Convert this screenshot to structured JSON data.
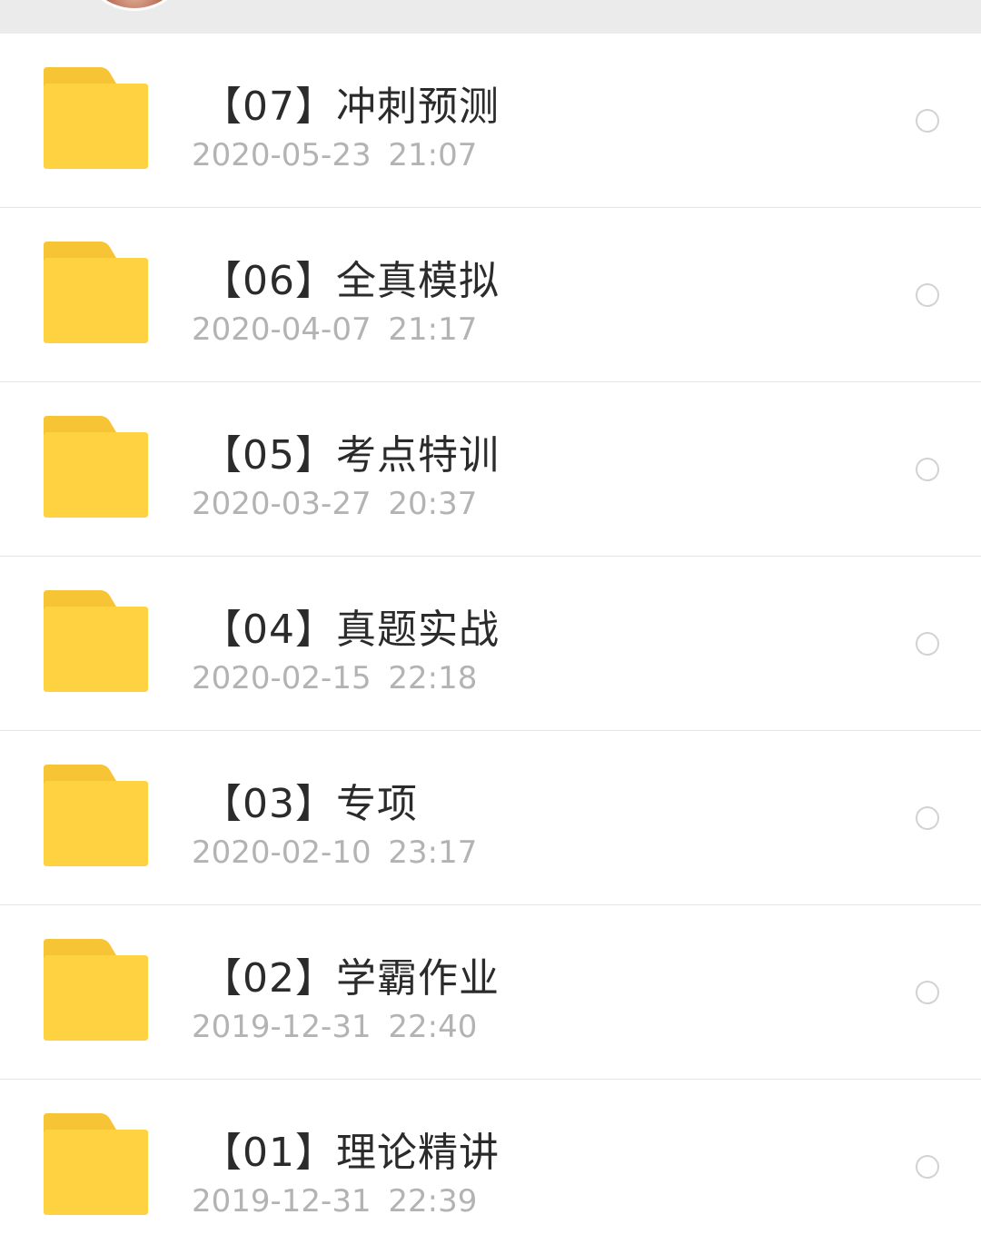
{
  "header": {
    "avatar_icon": "user-avatar"
  },
  "folders": [
    {
      "title": "【07】冲刺预测",
      "time": "2020-05-23  21:07",
      "icon": "folder-icon"
    },
    {
      "title": "【06】全真模拟",
      "time": "2020-04-07  21:17",
      "icon": "folder-icon"
    },
    {
      "title": "【05】考点特训",
      "time": "2020-03-27  20:37",
      "icon": "folder-icon"
    },
    {
      "title": "【04】真题实战",
      "time": "2020-02-15  22:18",
      "icon": "folder-icon"
    },
    {
      "title": "【03】专项",
      "time": "2020-02-10  23:17",
      "icon": "folder-icon"
    },
    {
      "title": "【02】学霸作业",
      "time": "2019-12-31  22:40",
      "icon": "folder-icon"
    },
    {
      "title": "【01】理论精讲",
      "time": "2019-12-31  22:39",
      "icon": "folder-icon"
    }
  ],
  "colors": {
    "folder": "#fed241",
    "folder_tab": "#f6c435",
    "title_text": "#2b2b2b",
    "time_text": "#b3b3b3",
    "divider": "#e6e6e6",
    "radio_border": "#d2d2d2"
  }
}
